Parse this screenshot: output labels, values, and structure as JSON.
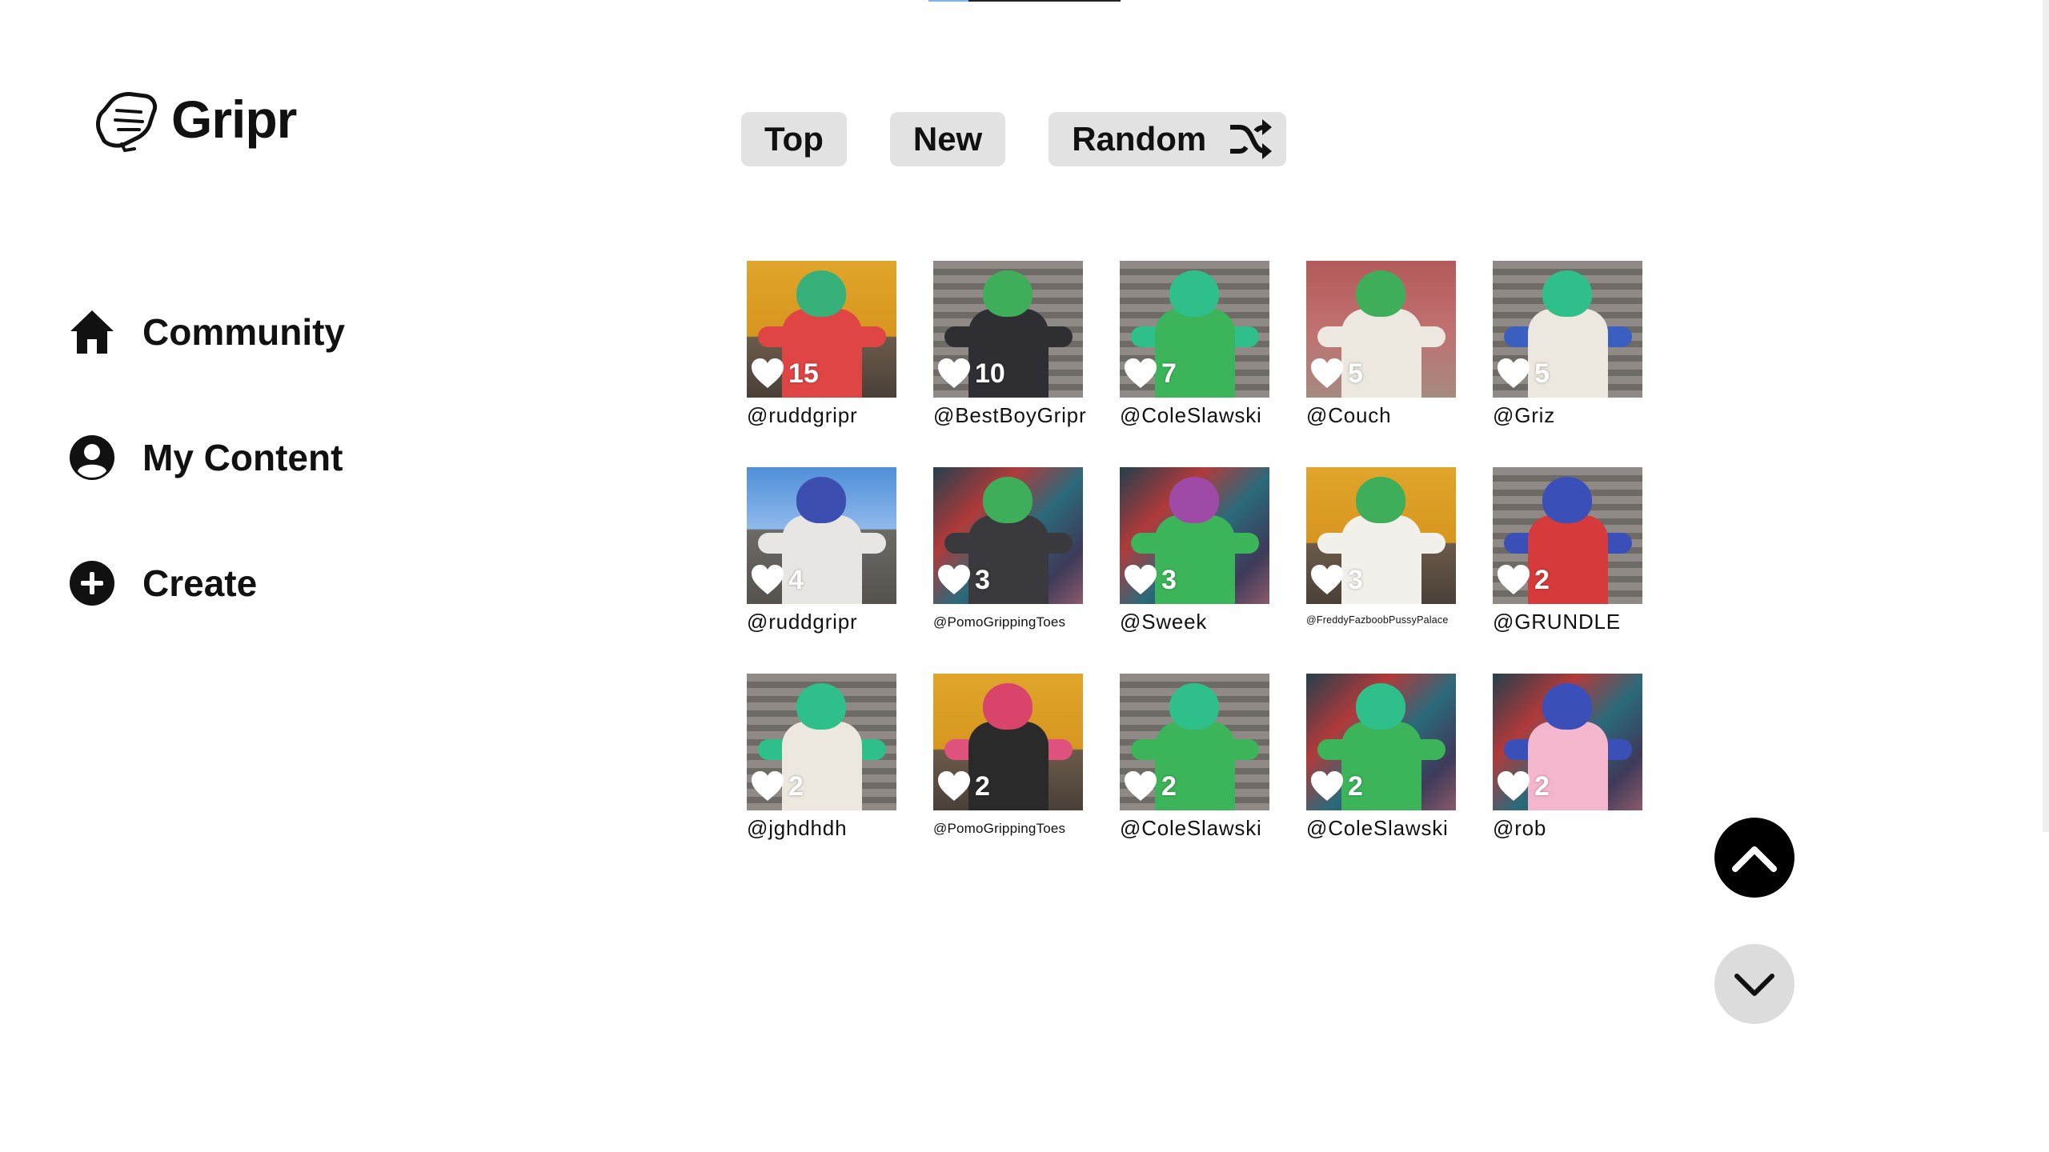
{
  "app": {
    "name": "Gripr",
    "logo_icon": "fist-icon"
  },
  "sidebar": {
    "items": [
      {
        "label": "Community",
        "icon": "home-icon"
      },
      {
        "label": "My Content",
        "icon": "user-circle-icon"
      },
      {
        "label": "Create",
        "icon": "plus-circle-icon"
      }
    ]
  },
  "sort_tabs": {
    "top": "Top",
    "new": "New",
    "random": "Random",
    "random_icon": "shuffle-icon"
  },
  "posts": [
    {
      "likes": "15",
      "handle": "@ruddgripr"
    },
    {
      "likes": "10",
      "handle": "@BestBoyGripr"
    },
    {
      "likes": "7",
      "handle": "@ColeSlawski"
    },
    {
      "likes": "5",
      "handle": "@Couch"
    },
    {
      "likes": "5",
      "handle": "@Griz"
    },
    {
      "likes": "4",
      "handle": "@ruddgripr"
    },
    {
      "likes": "3",
      "handle": "@PomoGrippingToes"
    },
    {
      "likes": "3",
      "handle": "@Sweek"
    },
    {
      "likes": "3",
      "handle": "@FreddyFazboobPussyPalace"
    },
    {
      "likes": "2",
      "handle": "@GRUNDLE"
    },
    {
      "likes": "2",
      "handle": "@jghdhdh"
    },
    {
      "likes": "2",
      "handle": "@PomoGrippingToes"
    },
    {
      "likes": "2",
      "handle": "@ColeSlawski"
    },
    {
      "likes": "2",
      "handle": "@ColeSlawski"
    },
    {
      "likes": "2",
      "handle": "@rob"
    }
  ],
  "scroll": {
    "up_icon": "chevron-up-icon",
    "down_icon": "chevron-down-icon"
  },
  "colors": {
    "tab_bg": "#e2e2e2",
    "scroll_up_bg": "#000000",
    "scroll_down_bg": "#dcdcdc"
  }
}
